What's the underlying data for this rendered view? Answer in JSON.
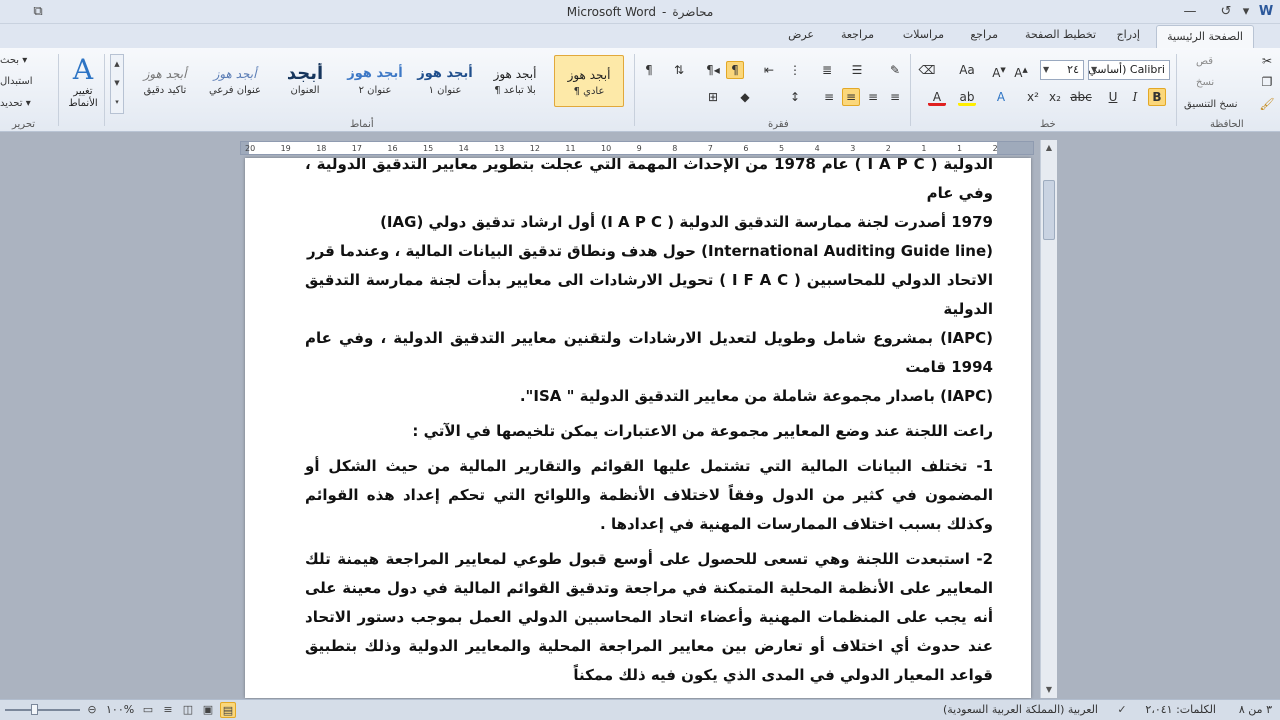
{
  "window": {
    "app_name": "Microsoft Word",
    "separator": "-",
    "doc_name": "محاضرة"
  },
  "tabs": [
    "الصفحة الرئيسية",
    "إدراج",
    "تخطيط الصفحة",
    "مراجع",
    "مراسلات",
    "مراجعة",
    "عرض"
  ],
  "clipboard": {
    "cut": "قص",
    "copy": "نسخ",
    "format_painter": "نسخ التنسيق",
    "label": "الحافظة"
  },
  "font": {
    "name": "Calibri (أساسي)",
    "size": "٢٤",
    "label": "خط"
  },
  "paragraph": {
    "label": "فقرة"
  },
  "styles": {
    "label": "أنماط",
    "change_styles": "تغيير الأنماط",
    "items": [
      {
        "sample": "أبجد هوز",
        "name": "¶ عادي"
      },
      {
        "sample": "أبجد هوز",
        "name": "¶ بلا تباعد"
      },
      {
        "sample": "أبجد هوز",
        "name": "عنوان ١"
      },
      {
        "sample": "أبجد هوز",
        "name": "عنوان ٢"
      },
      {
        "sample": "أبجد",
        "name": "العنوان"
      },
      {
        "sample": "أبجد هوز",
        "name": "عنوان فرعي"
      },
      {
        "sample": "أبجد هوز",
        "name": "تأكيد دقيق"
      }
    ]
  },
  "editing": {
    "find": "بحث",
    "replace": "استبدال",
    "select": "تحديد",
    "label": "تحرير"
  },
  "ruler": {
    "ticks": [
      "20",
      "19",
      "18",
      "17",
      "16",
      "15",
      "14",
      "13",
      "12",
      "11",
      "10",
      "9",
      "8",
      "7",
      "6",
      "5",
      "4",
      "3",
      "2",
      "1",
      "1",
      "2"
    ]
  },
  "document": {
    "lines": [
      "الدولية ( I A P C ) عام 1978 من الإحداث المهمة التي عجلت بتطوير معايير التدقيق الدولية ، وفي عام",
      "1979 أصدرت لجنة ممارسة التدقيق الدولية  ( I A P C)  أول ارشاد تدقيق دولي (IAG)",
      "(International Auditing Guide line) حول هدف ونطاق تدقيق البيانات المالية ، وعندما قرر",
      "الاتحاد الدولي للمحاسبين    ( I F A C ) تحويل الارشادات الى معايير بدأت لجنة ممارسة التدقيق الدولية",
      "(IAPC) بمشروع شامل وطويل لتعديل الارشادات ولتقنين معايير التدقيق الدولية ، وفي عام 1994 قامت",
      "(IAPC) باصدار مجموعة شاملة من معايير التدقيق الدولية \" ISA\"."
    ],
    "intro": "راعت اللجنة عند وضع المعايير مجموعة من الاعتبارات يمكن تلخيصها في الآتي :",
    "points": [
      "1- تختلف البيانات المالية التي تشتمل عليها القوائم والتقارير المالية من حيث الشكل أو المضمون في كثير من الدول وفقاً لاختلاف الأنظمة واللوائح التي تحكم إعداد هذه القوائم وكذلك بسبب اختلاف الممارسات المهنية في إعدادها .",
      "2- استبعدت اللجنة وهي تسعى للحصول على أوسع قبول طوعي لمعايير المراجعة هيمنة تلك المعايير على الأنظمة المحلية المتمكنة في مراجعة وتدقيق القوائم المالية في دول معينة على أنه يجب على المنظمات المهنية وأعضاء اتحاد المحاسبين الدولي العمل بموجب دستور الاتحاد عند حدوث أي اختلاف أو تعارض بين معايير المراجعة المحلية والمعايير الدولية وذلك بتطبيق قواعد المعيار الدولي في المدى الذي يكون فيه ذلك ممكناً"
    ]
  },
  "status": {
    "page": "٣ من ٨",
    "words": "الكلمات: ٢،٠٤١",
    "language": "العربية (المملكة العربية السعودية)",
    "zoom": "%١٠٠"
  }
}
